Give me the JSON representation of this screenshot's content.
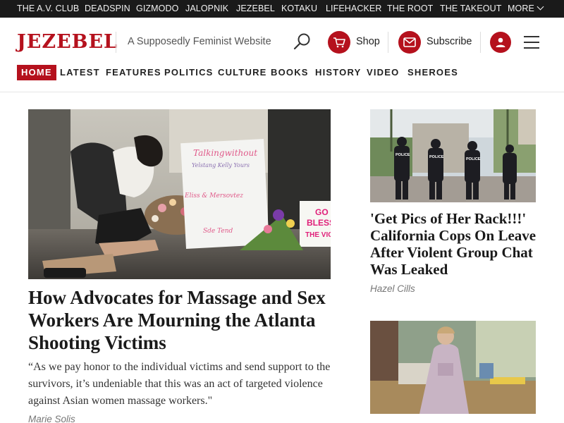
{
  "network": {
    "items": [
      "THE A.V. CLUB",
      "DEADSPIN",
      "GIZMODO",
      "JALOPNIK",
      "JEZEBEL",
      "KOTAKU",
      "LIFEHACKER",
      "THE ROOT",
      "THE TAKEOUT"
    ],
    "more_label": "MORE"
  },
  "header": {
    "logo": "JEZEBEL",
    "tagline": "A Supposedly Feminist Website",
    "shop_label": "Shop",
    "subscribe_label": "Subscribe"
  },
  "nav": {
    "items": [
      "HOME",
      "LATEST",
      "FEATURES",
      "POLITICS",
      "CULTURE",
      "BOOKS",
      "HISTORY",
      "VIDEO",
      "SHEROES"
    ],
    "active": "HOME"
  },
  "main_story": {
    "title": "How Advocates for Massage and Sex Workers Are Mourning the Atlanta Shooting Victims",
    "excerpt": "“As we pay honor to the individual victims and send support to the survivors, it’s undeniable that this was an act of targeted violence against Asian women massage workers.\"",
    "author": "Marie Solis",
    "image_signs": {
      "sign1_line1": "Talkingwithout",
      "sign1_line2": "Yelstang Kelly Yours",
      "sign1_line3": "Eliss & Mersovtez",
      "sign1_line4": "Sde Tend",
      "sign2_line1": "GO",
      "sign2_line2": "BLESS",
      "sign2_line3": "THE VICT"
    }
  },
  "side_stories": [
    {
      "title": "'Get Pics of Her Rack!!!' California Cops On Leave After Violent Group Chat Was Leaked",
      "author": "Hazel Cills",
      "image_text": [
        "POLICE",
        "POLICE",
        "POLICE"
      ]
    },
    {
      "title": "",
      "author": ""
    }
  ],
  "colors": {
    "brand": "#b5111d",
    "netbar": "#1a1a1a",
    "link_text": "#1a1a1a"
  }
}
